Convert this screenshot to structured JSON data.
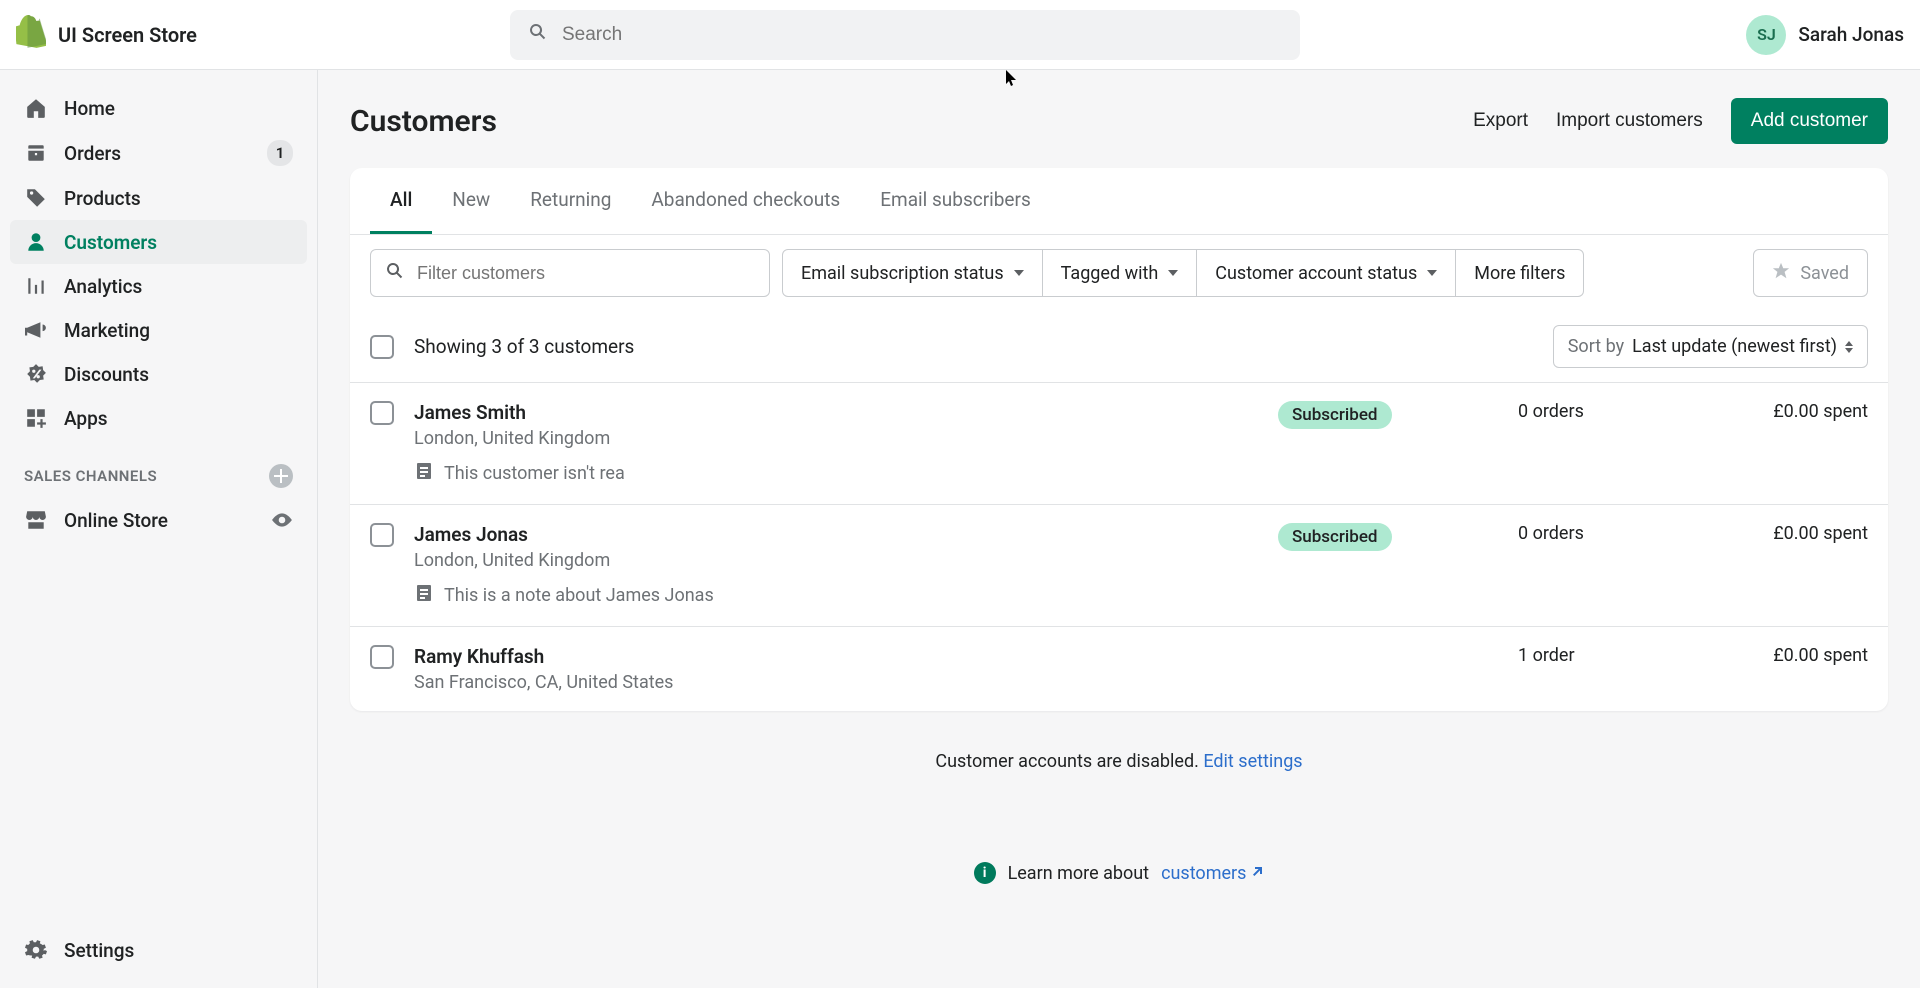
{
  "topbar": {
    "store_name": "UI Screen Store",
    "search_placeholder": "Search",
    "user_initials": "SJ",
    "user_name": "Sarah Jonas"
  },
  "sidebar": {
    "items": [
      {
        "label": "Home",
        "badge": null
      },
      {
        "label": "Orders",
        "badge": "1"
      },
      {
        "label": "Products",
        "badge": null
      },
      {
        "label": "Customers",
        "badge": null,
        "active": true
      },
      {
        "label": "Analytics",
        "badge": null
      },
      {
        "label": "Marketing",
        "badge": null
      },
      {
        "label": "Discounts",
        "badge": null
      },
      {
        "label": "Apps",
        "badge": null
      }
    ],
    "section_title": "SALES CHANNELS",
    "channels": [
      {
        "label": "Online Store"
      }
    ],
    "settings_label": "Settings"
  },
  "page": {
    "title": "Customers",
    "actions": {
      "export": "Export",
      "import": "Import customers",
      "add": "Add customer"
    }
  },
  "tabs": [
    {
      "label": "All",
      "active": true
    },
    {
      "label": "New"
    },
    {
      "label": "Returning"
    },
    {
      "label": "Abandoned checkouts"
    },
    {
      "label": "Email subscribers"
    }
  ],
  "filters": {
    "search_placeholder": "Filter customers",
    "pills": [
      {
        "label": "Email subscription status"
      },
      {
        "label": "Tagged with"
      },
      {
        "label": "Customer account status"
      },
      {
        "label": "More filters"
      }
    ],
    "saved_label": "Saved"
  },
  "list_meta": {
    "showing": "Showing 3 of 3 customers",
    "sort_label": "Sort by",
    "sort_value": "Last update (newest first)"
  },
  "customers": [
    {
      "name": "James Smith",
      "location": "London, United Kingdom",
      "note": "This customer isn't rea",
      "status": "Subscribed",
      "orders": "0 orders",
      "spent": "£0.00 spent"
    },
    {
      "name": "James Jonas",
      "location": "London, United Kingdom",
      "note": "This is a note about James Jonas",
      "status": "Subscribed",
      "orders": "0 orders",
      "spent": "£0.00 spent"
    },
    {
      "name": "Ramy Khuffash",
      "location": "San Francisco, CA, United States",
      "note": null,
      "status": null,
      "orders": "1 order",
      "spent": "£0.00 spent"
    }
  ],
  "footer": {
    "disabled_msg": "Customer accounts are disabled.",
    "edit_link": "Edit settings",
    "learn_prefix": "Learn more about",
    "learn_link": "customers"
  }
}
